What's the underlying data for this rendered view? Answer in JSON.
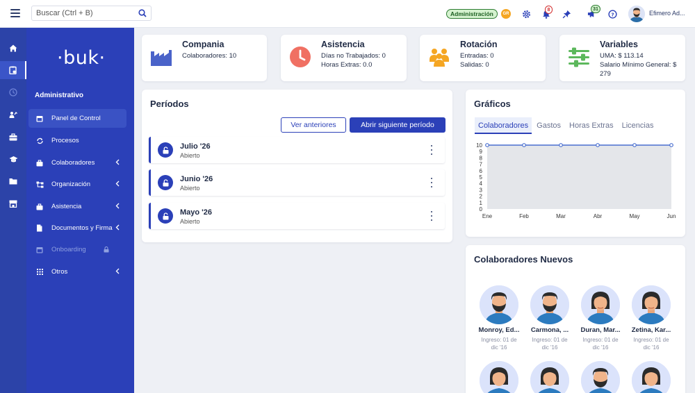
{
  "topbar": {
    "search_placeholder": "Buscar (Ctrl + B)",
    "admin_badge": "Administración",
    "notifications_count": "8",
    "messages_count": "31",
    "user_name": "Efimero Ad..."
  },
  "sidebar": {
    "logo": "·buk·",
    "section": "Administrativo",
    "items": [
      {
        "label": "Panel de Control"
      },
      {
        "label": "Procesos"
      },
      {
        "label": "Colaboradores"
      },
      {
        "label": "Organización"
      },
      {
        "label": "Asistencia"
      },
      {
        "label": "Documentos y Firma"
      },
      {
        "label": "Onboarding"
      },
      {
        "label": "Otros"
      }
    ]
  },
  "kpis": [
    {
      "title": "Compania",
      "lines": [
        "Colaboradores: 10"
      ]
    },
    {
      "title": "Asistencia",
      "lines": [
        "Días no Trabajados: 0",
        "Horas Extras: 0.0"
      ]
    },
    {
      "title": "Rotación",
      "lines": [
        "Entradas: 0",
        "Salidas: 0"
      ]
    },
    {
      "title": "Variables",
      "lines": [
        "UMA: $ 113.14",
        "Salario Mínimo General: $",
        "279"
      ]
    }
  ],
  "periodos": {
    "title": "Períodos",
    "btn_prev": "Ver anteriores",
    "btn_next": "Abrir siguiente período",
    "items": [
      {
        "name": "Julio '26",
        "status": "Abierto"
      },
      {
        "name": "Junio '26",
        "status": "Abierto"
      },
      {
        "name": "Mayo '26",
        "status": "Abierto"
      }
    ]
  },
  "graficos": {
    "title": "Gráficos",
    "tabs": [
      "Colaboradores",
      "Gastos",
      "Horas Extras",
      "Licencias"
    ]
  },
  "chart_data": {
    "type": "area",
    "categories": [
      "Ene",
      "Feb",
      "Mar",
      "Abr",
      "May",
      "Jun"
    ],
    "values": [
      10,
      10,
      10,
      10,
      10,
      10
    ],
    "ylim": [
      0,
      10
    ],
    "yticks": [
      "10",
      "9",
      "8",
      "7",
      "6",
      "5",
      "4",
      "3",
      "2",
      "1",
      "0"
    ],
    "line_color": "#4a6fd0",
    "fill_color": "#e4e6ea",
    "grid": false
  },
  "nuevos": {
    "title": "Colaboradores Nuevos",
    "people": [
      {
        "name": "Monroy, Ed...",
        "sub1": "Ingreso: 01 de",
        "sub2": "dic '16"
      },
      {
        "name": "Carmona, ...",
        "sub1": "Ingreso: 01 de",
        "sub2": "dic '16"
      },
      {
        "name": "Duran, Mar...",
        "sub1": "Ingreso: 01 de",
        "sub2": "dic '16"
      },
      {
        "name": "Zetina, Kar...",
        "sub1": "Ingreso: 01 de",
        "sub2": "dic '16"
      }
    ]
  },
  "colors": {
    "primary": "#2b40b8",
    "rail": "#2c43a8",
    "accent_orange": "#f5a623",
    "admin_green": "#1b5e20"
  }
}
